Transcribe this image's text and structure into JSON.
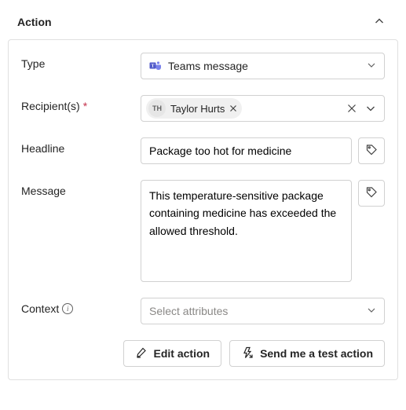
{
  "header": {
    "title": "Action"
  },
  "fields": {
    "type": {
      "label": "Type",
      "value": "Teams message"
    },
    "recipients": {
      "label": "Recipient(s)",
      "required_marker": "*",
      "chips": [
        {
          "initials": "TH",
          "name": "Taylor Hurts"
        }
      ]
    },
    "headline": {
      "label": "Headline",
      "value": "Package too hot for medicine"
    },
    "message": {
      "label": "Message",
      "value": "This temperature-sensitive package containing medicine has exceeded the allowed threshold."
    },
    "context": {
      "label": "Context",
      "placeholder": "Select attributes"
    }
  },
  "buttons": {
    "edit": "Edit action",
    "send_test": "Send me a test action"
  }
}
